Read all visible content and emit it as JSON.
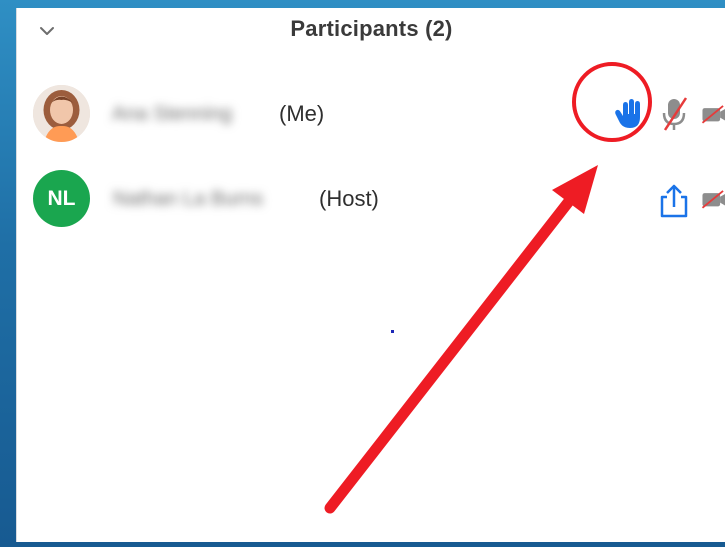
{
  "panel": {
    "title": "Participants (2)"
  },
  "participants": [
    {
      "name": "Ana Stenning",
      "tag": "(Me)",
      "avatar_type": "photo",
      "raised_hand": true,
      "mic": "muted",
      "video": "off"
    },
    {
      "name": "Nathan La Burns",
      "tag": "(Host)",
      "avatar_type": "initials",
      "initials": "NL",
      "sharing": true,
      "video": "off"
    }
  ],
  "icons": {
    "collapse": "chevron-down-icon",
    "raise_hand": "hand-icon",
    "mic_muted": "microphone-muted-icon",
    "video_off": "video-off-icon",
    "share": "share-icon"
  },
  "colors": {
    "background_blue": "#1f6fa6",
    "avatar_green": "#1aa64f",
    "hand_blue": "#1a73e8",
    "annotation_red": "#ee1c24",
    "muted_red": "#e63b3b"
  }
}
